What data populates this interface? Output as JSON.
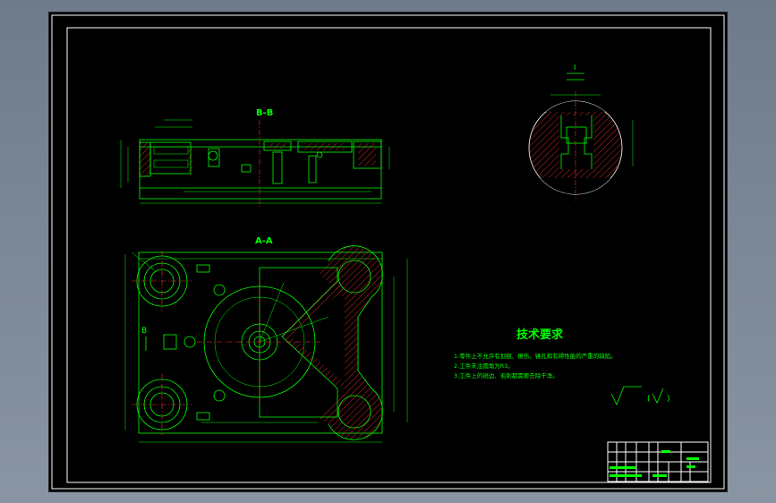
{
  "sections": {
    "section_bb": "B-B",
    "section_aa": "A-A",
    "marker_b": "B",
    "detail_label": "I"
  },
  "technical_requirements": {
    "title": "技术要求",
    "items": [
      "1.零件上不允许有划痕、擦伤、锈孔和有碍性能的严重的缺陷。",
      "2.工件未注圆角为R3。",
      "3.工件上的锐边、毛刺都需要去除干净。"
    ]
  },
  "roughness": {
    "open_paren": "(",
    "close_paren": ")"
  },
  "colors": {
    "background": "#000000",
    "frame": "#ffffff",
    "outline": "#00ff00",
    "centerline": "#ff3030",
    "hatch": "#ff3030",
    "text": "#00ff00"
  }
}
